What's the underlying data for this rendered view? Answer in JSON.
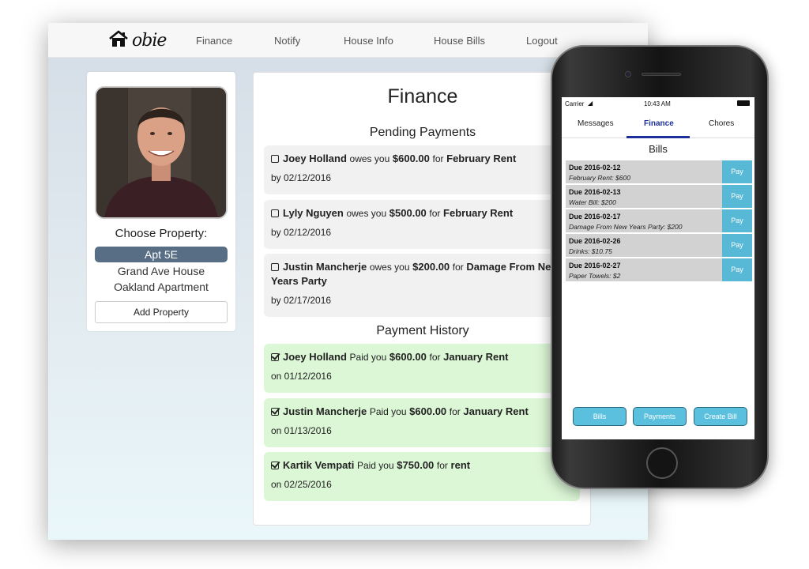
{
  "desktop": {
    "logo_text": "obie",
    "nav": [
      "Finance",
      "Notify",
      "House Info",
      "House Bills",
      "Logout"
    ],
    "profile": {
      "choose_title": "Choose Property:",
      "selected": "Apt 5E",
      "others": [
        "Grand Ave House",
        "Oakland Apartment"
      ],
      "add_button": "Add Property"
    },
    "finance": {
      "title": "Finance",
      "pending_title": "Pending Payments",
      "pending": [
        {
          "name": "Joey Holland",
          "verb": "owes you",
          "amount": "$600.00",
          "for": "for",
          "item": "February Rent",
          "date": "by 02/12/2016"
        },
        {
          "name": "Lyly Nguyen",
          "verb": "owes you",
          "amount": "$500.00",
          "for": "for",
          "item": "February Rent",
          "date": "by 02/12/2016"
        },
        {
          "name": "Justin Mancherje",
          "verb": "owes you",
          "amount": "$200.00",
          "for": "for",
          "item": "Damage From New Years Party",
          "date": "by 02/17/2016"
        }
      ],
      "history_title": "Payment History",
      "history": [
        {
          "name": "Joey Holland",
          "verb": "Paid you",
          "amount": "$600.00",
          "for": "for",
          "item": "January Rent",
          "date": "on 01/12/2016"
        },
        {
          "name": "Justin Mancherje",
          "verb": "Paid you",
          "amount": "$600.00",
          "for": "for",
          "item": "January Rent",
          "date": "on 01/13/2016"
        },
        {
          "name": "Kartik Vempati",
          "verb": "Paid you",
          "amount": "$750.00",
          "for": "for",
          "item": "rent",
          "date": "on 02/25/2016"
        }
      ]
    }
  },
  "phone": {
    "carrier": "Carrier",
    "time": "10:43 AM",
    "tabs": [
      "Messages",
      "Finance",
      "Chores"
    ],
    "active_tab": "Finance",
    "bills_title": "Bills",
    "pay_label": "Pay",
    "bills": [
      {
        "due": "Due 2016-02-12",
        "desc": "February Rent: $600"
      },
      {
        "due": "Due 2016-02-13",
        "desc": "Water Bill: $200"
      },
      {
        "due": "Due 2016-02-17",
        "desc": "Damage From New Years Party: $200"
      },
      {
        "due": "Due 2016-02-26",
        "desc": "Drinks: $10.75"
      },
      {
        "due": "Due 2016-02-27",
        "desc": "Paper Towels: $2"
      }
    ],
    "bottom_buttons": [
      "Bills",
      "Payments",
      "Create Bill"
    ],
    "colors": {
      "accent": "#1d2f9a",
      "pay_button": "#58b9d6",
      "selected_property": "#586e84",
      "history_bg": "#dcf7d6"
    }
  }
}
